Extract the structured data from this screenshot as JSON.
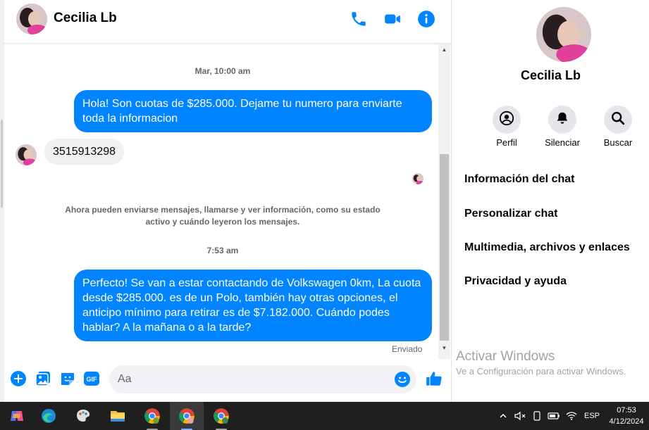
{
  "contact": {
    "name": "Cecilia Lb"
  },
  "header": {
    "call": "phone-icon",
    "video": "video-call-icon",
    "info": "info-icon"
  },
  "messages": {
    "ts1": "Mar, 10:00 am",
    "out1": "Hola! Son cuotas de $285.000. Dejame tu numero para enviarte toda la informacion",
    "in1": "3515913298",
    "system": "Ahora pueden enviarse mensajes, llamarse y ver información, como su estado activo y cuándo leyeron los mensajes.",
    "ts2": "7:53 am",
    "out2": "Perfecto!  Se van a estar contactando de Volkswagen 0km, La cuota desde $285.000. es de un Polo, también hay otras opciones, el anticipo mínimo para retirar es de $7.182.000. Cuándo podes hablar? A la mañana o a la tarde?",
    "status": "Enviado"
  },
  "composer": {
    "placeholder": "Aa",
    "value": ""
  },
  "sidebar": {
    "name": "Cecilia Lb",
    "actions": [
      {
        "label": "Perfil",
        "icon": "profile-icon"
      },
      {
        "label": "Silenciar",
        "icon": "bell-icon"
      },
      {
        "label": "Buscar",
        "icon": "search-icon"
      }
    ],
    "menu": [
      "Información del chat",
      "Personalizar chat",
      "Multimedia, archivos y enlaces",
      "Privacidad y ayuda"
    ]
  },
  "watermark": {
    "title": "Activar Windows",
    "subtitle": "Ve a Configuración para activar Windows."
  },
  "taskbar": {
    "lang": "ESP",
    "time": "07:53",
    "date": "4/12/2024"
  },
  "colors": {
    "accent": "#0084ff",
    "bubble_in": "#f0f0f0",
    "taskbar": "#1f1f1f"
  }
}
